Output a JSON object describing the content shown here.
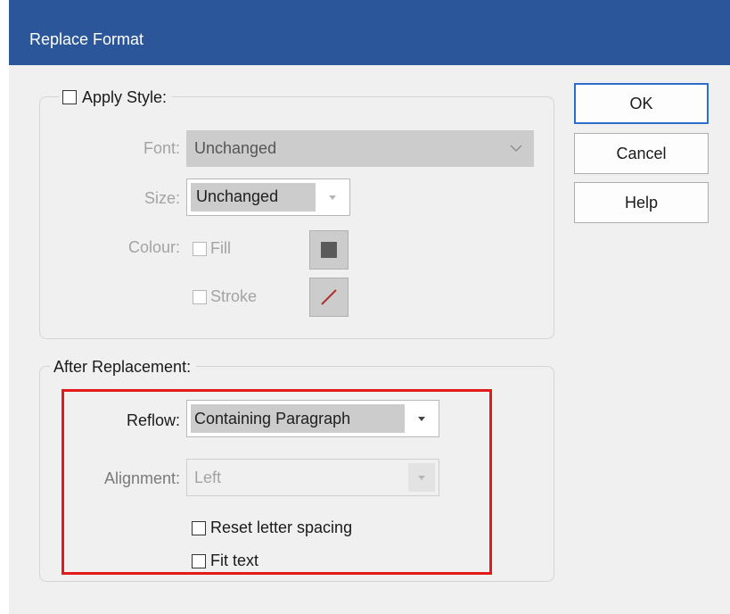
{
  "window": {
    "title": "Replace Format"
  },
  "apply_style": {
    "checkbox_label": "Apply Style:",
    "checked": false,
    "font": {
      "label": "Font:",
      "value": "Unchanged"
    },
    "size": {
      "label": "Size:",
      "value": "Unchanged"
    },
    "colour": {
      "label": "Colour:",
      "fill_label": "Fill",
      "fill_checked": false,
      "fill_color": "#5a5a5a",
      "stroke_label": "Stroke",
      "stroke_checked": false,
      "stroke_color": "#b03030"
    }
  },
  "after_replacement": {
    "legend": "After Replacement:",
    "reflow": {
      "label": "Reflow:",
      "value": "Containing Paragraph"
    },
    "alignment": {
      "label": "Alignment:",
      "value": "Left"
    },
    "reset_letter_spacing": {
      "label": "Reset letter spacing",
      "checked": false
    },
    "fit_text": {
      "label": "Fit text",
      "checked": false
    }
  },
  "buttons": {
    "ok": "OK",
    "cancel": "Cancel",
    "help": "Help"
  },
  "colors": {
    "titlebar": "#2b579a",
    "highlight": "#e31a1a",
    "default_button_border": "#2f6fc9"
  }
}
